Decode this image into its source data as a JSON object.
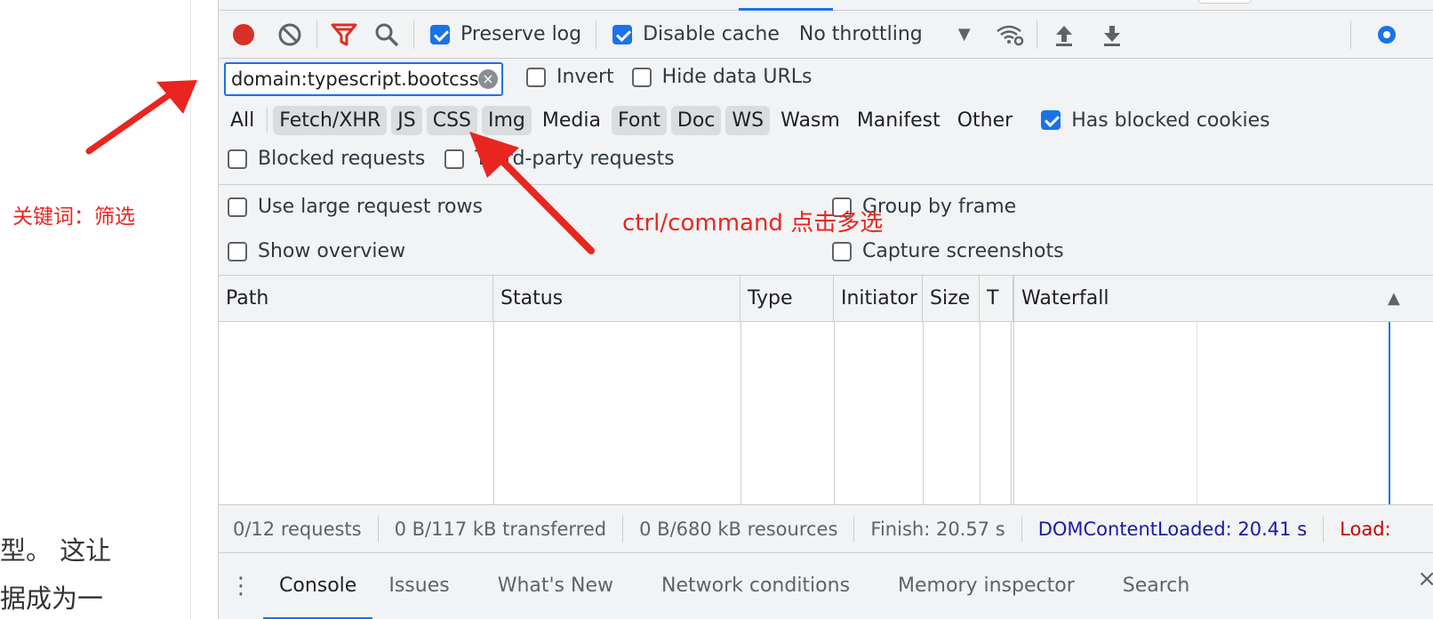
{
  "left_page": {
    "side_note": "关键词：筛选",
    "text_line1": "型。 这让",
    "text_line2": "据成为一"
  },
  "toolbar": {
    "preserve_log": {
      "label": "Preserve log",
      "checked": true
    },
    "disable_cache": {
      "label": "Disable cache",
      "checked": true
    },
    "throttling": {
      "value": "No throttling",
      "caret": "▼"
    }
  },
  "filter": {
    "value": "domain:typescript.bootcss.",
    "clear": "×",
    "invert": {
      "label": "Invert",
      "checked": false
    },
    "hide_data_urls": {
      "label": "Hide data URLs",
      "checked": false
    },
    "types": [
      {
        "label": "All",
        "selected": false
      },
      {
        "label": "Fetch/XHR",
        "selected": true
      },
      {
        "label": "JS",
        "selected": true
      },
      {
        "label": "CSS",
        "selected": true
      },
      {
        "label": "Img",
        "selected": true
      },
      {
        "label": "Media",
        "selected": false
      },
      {
        "label": "Font",
        "selected": true
      },
      {
        "label": "Doc",
        "selected": true
      },
      {
        "label": "WS",
        "selected": true
      },
      {
        "label": "Wasm",
        "selected": false
      },
      {
        "label": "Manifest",
        "selected": false
      },
      {
        "label": "Other",
        "selected": false
      }
    ],
    "has_blocked_cookies": {
      "label": "Has blocked cookies",
      "checked": true
    },
    "blocked_requests": {
      "label": "Blocked requests",
      "checked": false
    },
    "third_party": {
      "label": "Third-party requests",
      "checked": false
    }
  },
  "settings": {
    "large_rows": {
      "label": "Use large request rows",
      "checked": false
    },
    "group_by_frame": {
      "label": "Group by frame",
      "checked": false
    },
    "show_overview": {
      "label": "Show overview",
      "checked": false
    },
    "capture_screenshots": {
      "label": "Capture screenshots",
      "checked": false
    }
  },
  "table": {
    "columns": [
      "Path",
      "Status",
      "Type",
      "Initiator",
      "Size",
      "T",
      "Waterfall"
    ],
    "sort_indicator": "▲"
  },
  "status_bar": {
    "requests": "0/12 requests",
    "transferred": "0 B/117 kB transferred",
    "resources": "0 B/680 kB resources",
    "finish": "Finish: 20.57 s",
    "dcl": "DOMContentLoaded: 20.41 s",
    "load": "Load:"
  },
  "drawer": {
    "tabs": [
      "Console",
      "Issues",
      "What's New",
      "Network conditions",
      "Memory inspector",
      "Search"
    ],
    "close": "×"
  },
  "annotation": {
    "text": "ctrl/command 点击多选",
    "color": "#e8261f"
  },
  "colors": {
    "accent": "#1a73e8",
    "record": "#d93025",
    "filter_icon": "#d93025"
  }
}
